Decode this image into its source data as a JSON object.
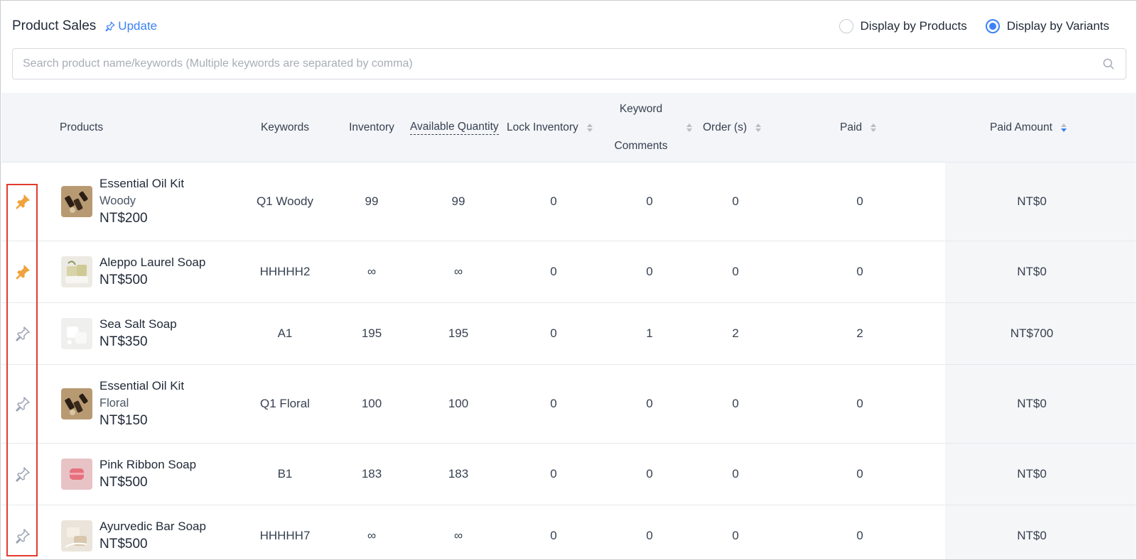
{
  "header": {
    "title": "Product Sales",
    "update_label": "Update",
    "radio_products": "Display by Products",
    "radio_variants": "Display by Variants",
    "selected_radio": "variants"
  },
  "search": {
    "placeholder": "Search product name/keywords (Multiple keywords are separated by comma)",
    "value": ""
  },
  "table": {
    "columns": {
      "products": "Products",
      "keywords": "Keywords",
      "inventory": "Inventory",
      "available_quantity": "Available Quantity",
      "lock_inventory": "Lock Inventory",
      "keyword_line1": "Keyword",
      "keyword_line2": "Comments",
      "orders": "Order (s)",
      "paid": "Paid",
      "paid_amount": "Paid Amount"
    },
    "rows": [
      {
        "name": "Essential Oil Kit",
        "variant": "Woody",
        "price": "NT$200",
        "keyword": "Q1 Woody",
        "inventory": "99",
        "available": "99",
        "lock": "0",
        "comments": "0",
        "orders": "0",
        "paid": "0",
        "amount": "NT$0",
        "pinned": true,
        "thumb": "oil"
      },
      {
        "name": "Aleppo Laurel Soap",
        "variant": "",
        "price": "NT$500",
        "keyword": "HHHHH2",
        "inventory": "∞",
        "available": "∞",
        "lock": "0",
        "comments": "0",
        "orders": "0",
        "paid": "0",
        "amount": "NT$0",
        "pinned": true,
        "thumb": "laurel"
      },
      {
        "name": "Sea Salt Soap",
        "variant": "",
        "price": "NT$350",
        "keyword": "A1",
        "inventory": "195",
        "available": "195",
        "lock": "0",
        "comments": "1",
        "orders": "2",
        "paid": "2",
        "amount": "NT$700",
        "pinned": false,
        "thumb": "salt"
      },
      {
        "name": "Essential Oil Kit",
        "variant": "Floral",
        "price": "NT$150",
        "keyword": "Q1 Floral",
        "inventory": "100",
        "available": "100",
        "lock": "0",
        "comments": "0",
        "orders": "0",
        "paid": "0",
        "amount": "NT$0",
        "pinned": false,
        "thumb": "oil"
      },
      {
        "name": "Pink Ribbon Soap",
        "variant": "",
        "price": "NT$500",
        "keyword": "B1",
        "inventory": "183",
        "available": "183",
        "lock": "0",
        "comments": "0",
        "orders": "0",
        "paid": "0",
        "amount": "NT$0",
        "pinned": false,
        "thumb": "pink"
      },
      {
        "name": "Ayurvedic Bar Soap",
        "variant": "",
        "price": "NT$500",
        "keyword": "HHHHH7",
        "inventory": "∞",
        "available": "∞",
        "lock": "0",
        "comments": "0",
        "orders": "0",
        "paid": "0",
        "amount": "NT$0",
        "pinned": false,
        "thumb": "ayur"
      }
    ]
  },
  "icons": {
    "pin_filled": "pin-filled-icon",
    "pin_outline": "pin-outline-icon",
    "search": "search-icon"
  },
  "colors": {
    "accent": "#3b82f6",
    "pin_active": "#f0a23b",
    "pin_inactive": "#9aa3b2",
    "highlight": "#e23b2e"
  }
}
